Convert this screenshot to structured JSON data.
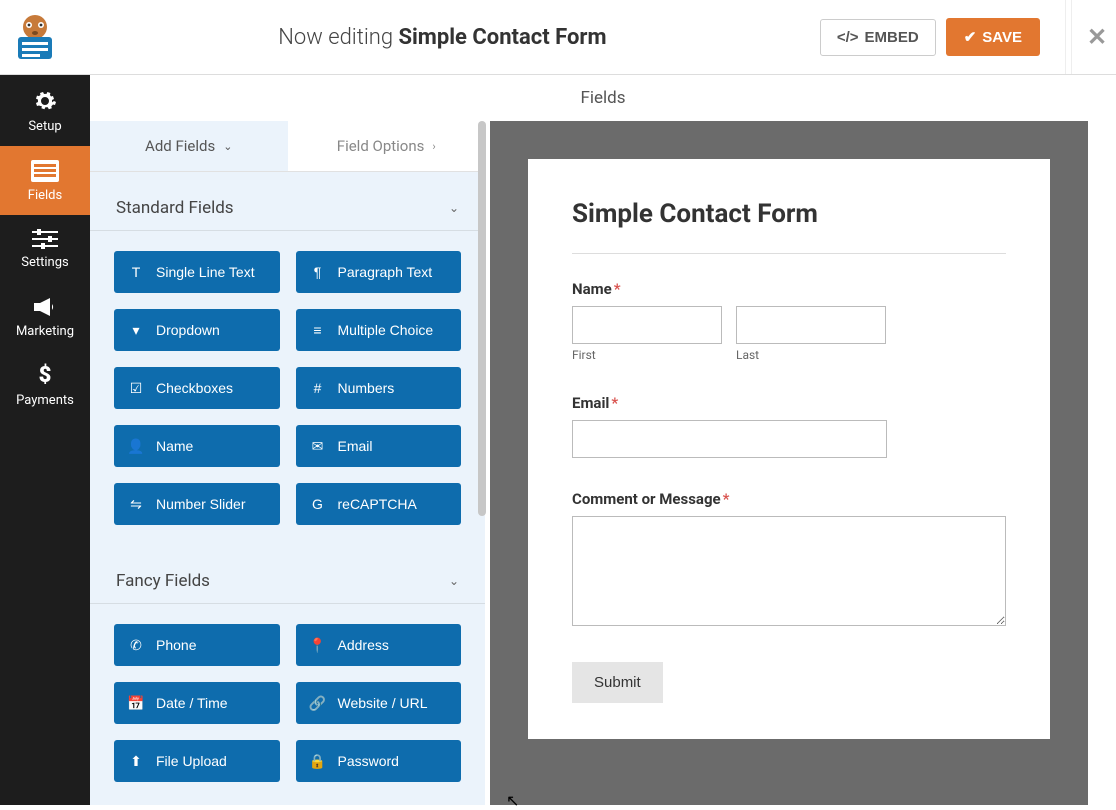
{
  "header": {
    "editing_prefix": "Now editing ",
    "form_name": "Simple Contact Form",
    "embed_label": "EMBED",
    "save_label": "SAVE"
  },
  "leftnav": {
    "items": [
      {
        "label": "Setup",
        "icon": "⚙"
      },
      {
        "label": "Fields",
        "icon": "▤"
      },
      {
        "label": "Settings",
        "icon": "⚙"
      },
      {
        "label": "Marketing",
        "icon": "📣"
      },
      {
        "label": "Payments",
        "icon": "$"
      }
    ],
    "active_index": 1
  },
  "panel_title": "Fields",
  "tabs": {
    "add_fields": "Add Fields",
    "field_options": "Field Options"
  },
  "sections": {
    "standard": {
      "title": "Standard Fields",
      "fields": [
        {
          "label": "Single Line Text",
          "icon": "single-line-text-icon"
        },
        {
          "label": "Paragraph Text",
          "icon": "paragraph-text-icon"
        },
        {
          "label": "Dropdown",
          "icon": "dropdown-icon"
        },
        {
          "label": "Multiple Choice",
          "icon": "multiple-choice-icon"
        },
        {
          "label": "Checkboxes",
          "icon": "checkboxes-icon"
        },
        {
          "label": "Numbers",
          "icon": "numbers-icon"
        },
        {
          "label": "Name",
          "icon": "name-icon"
        },
        {
          "label": "Email",
          "icon": "email-icon"
        },
        {
          "label": "Number Slider",
          "icon": "number-slider-icon"
        },
        {
          "label": "reCAPTCHA",
          "icon": "recaptcha-icon"
        }
      ]
    },
    "fancy": {
      "title": "Fancy Fields",
      "fields": [
        {
          "label": "Phone",
          "icon": "phone-icon"
        },
        {
          "label": "Address",
          "icon": "address-icon"
        },
        {
          "label": "Date / Time",
          "icon": "date-time-icon"
        },
        {
          "label": "Website / URL",
          "icon": "website-url-icon"
        },
        {
          "label": "File Upload",
          "icon": "file-upload-icon"
        },
        {
          "label": "Password",
          "icon": "password-icon"
        }
      ]
    }
  },
  "preview": {
    "form_title": "Simple Contact Form",
    "name_label": "Name",
    "first_sublabel": "First",
    "last_sublabel": "Last",
    "email_label": "Email",
    "comment_label": "Comment or Message",
    "submit_label": "Submit",
    "required_marker": "*"
  },
  "colors": {
    "accent": "#e27730",
    "field_btn": "#0e6cad"
  },
  "icons": {
    "single-line-text-icon": "T",
    "paragraph-text-icon": "¶",
    "dropdown-icon": "▾",
    "multiple-choice-icon": "≡",
    "checkboxes-icon": "☑",
    "numbers-icon": "#",
    "name-icon": "👤",
    "email-icon": "✉",
    "number-slider-icon": "⇋",
    "recaptcha-icon": "G",
    "phone-icon": "✆",
    "address-icon": "📍",
    "date-time-icon": "📅",
    "website-url-icon": "🔗",
    "file-upload-icon": "⬆",
    "password-icon": "🔒"
  }
}
